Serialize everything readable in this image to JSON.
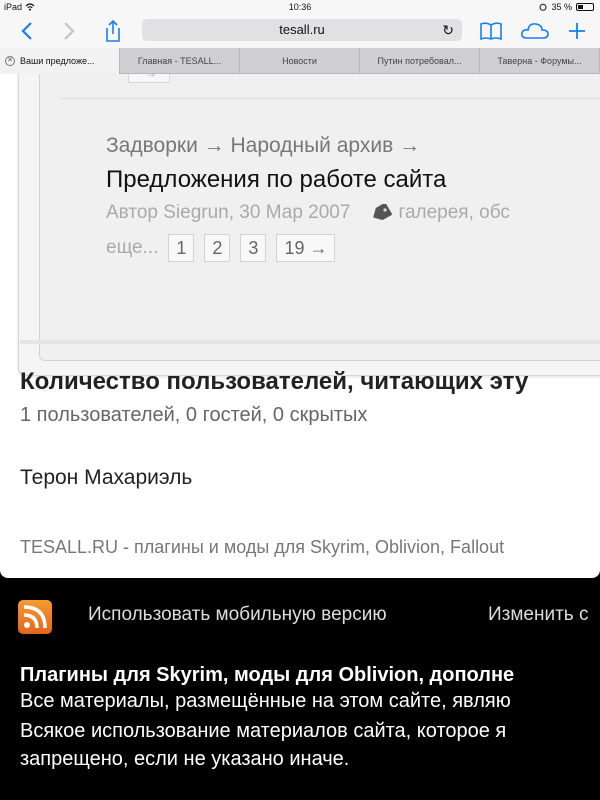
{
  "status_bar": {
    "device": "iPad",
    "time": "10:36",
    "battery_text": "35 %",
    "battery_level": 0.35
  },
  "toolbar": {
    "url": "tesall.ru"
  },
  "tabs": [
    {
      "label": "Ваши предложе...",
      "active": true
    },
    {
      "label": "Главная - TESALL...",
      "active": false
    },
    {
      "label": "Новости",
      "active": false
    },
    {
      "label": "Путин потребовал...",
      "active": false
    },
    {
      "label": "Таверна - Форумы...",
      "active": false
    }
  ],
  "topic": {
    "prev_arrow": "→",
    "breadcrumb": "Задворки → Народный архив →",
    "title": "Предложения по работе сайта",
    "meta": "Автор Siegrun, 30 Мар 2007",
    "tags": "галерея, обс",
    "pages_label": "еще...",
    "pages": [
      "1",
      "2",
      "3",
      "19 →"
    ]
  },
  "readers": {
    "title": "Количество пользователей, читающих эту",
    "counts": "1 пользователей, 0 гостей, 0 скрытых",
    "users": [
      "Терон Махариэль"
    ]
  },
  "site_description": "TESALL.RU - плагины и моды для Skyrim, Oblivion, Fallout",
  "footer": {
    "mobile_link": "Использовать мобильную версию",
    "change_link": "Изменить с",
    "title": "Плагины для Skyrim, моды для Oblivion, дополне",
    "lines": [
      "Все материалы, размещённые на этом сайте, являю",
      "Всякое использование материалов сайта, которое я",
      "запрещено, если не указано иначе."
    ]
  },
  "colors": {
    "accent": "#1a7ef5",
    "rss": "#f08a2c"
  }
}
